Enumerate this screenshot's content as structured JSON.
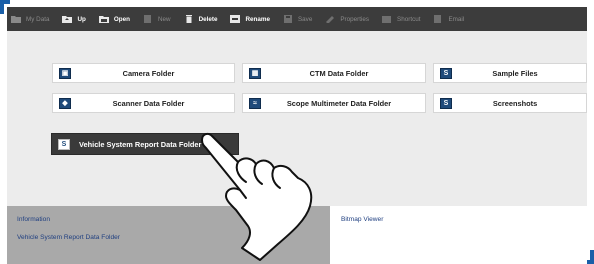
{
  "toolbar": {
    "items": [
      {
        "label": "My Data",
        "enabled": false,
        "icon": "folder-icon"
      },
      {
        "label": "Up",
        "enabled": true,
        "icon": "folder-up-icon"
      },
      {
        "label": "Open",
        "enabled": true,
        "icon": "open-folder-icon"
      },
      {
        "label": "New",
        "enabled": false,
        "icon": "new-folder-icon"
      },
      {
        "label": "Delete",
        "enabled": true,
        "icon": "trash-icon"
      },
      {
        "label": "Rename",
        "enabled": true,
        "icon": "rename-icon"
      },
      {
        "label": "Save",
        "enabled": false,
        "icon": "save-icon"
      },
      {
        "label": "Properties",
        "enabled": false,
        "icon": "properties-icon"
      },
      {
        "label": "Shortcut",
        "enabled": false,
        "icon": "shortcut-icon"
      },
      {
        "label": "Email",
        "enabled": false,
        "icon": "email-icon"
      }
    ]
  },
  "folders": {
    "camera": "Camera Folder",
    "ctm": "CTM Data Folder",
    "sample": "Sample Files",
    "scanner": "Scanner Data Folder",
    "scope": "Scope Multimeter Data Folder",
    "screenshots": "Screenshots",
    "vehicle_report": "Vehicle System Report Data Folder"
  },
  "info_panel": {
    "title": "Information",
    "value": "Vehicle System Report Data Folder"
  },
  "viewer_panel": {
    "title": "Bitmap Viewer"
  },
  "colors": {
    "toolbar_bg": "#3c3c3c",
    "accent_blue": "#1a5fa8",
    "selected_bg": "#3a3a3a",
    "info_bg": "#a9a9a9"
  }
}
